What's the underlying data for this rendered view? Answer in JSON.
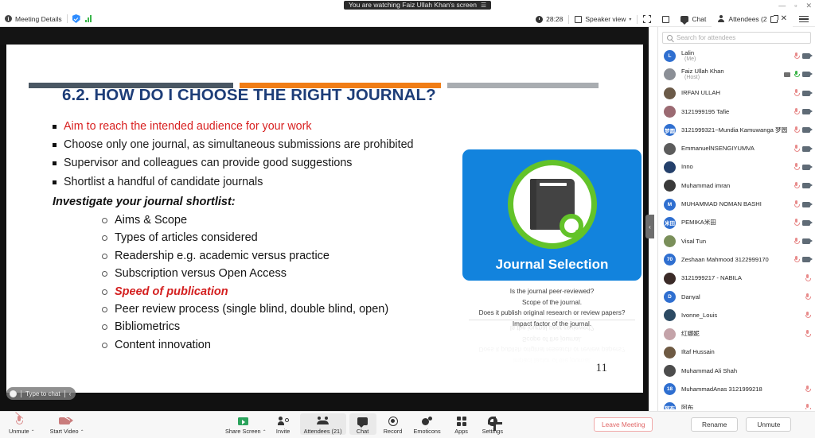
{
  "window": {
    "minimize": "—",
    "maximize": "▫",
    "close": "✕"
  },
  "screenshare_banner": {
    "text": "You are watching Faiz Ullah Khan's screen",
    "menu_icon": "menu-icon"
  },
  "topbar": {
    "meeting_details": "Meeting Details",
    "encryption_icon": "shield-check-icon",
    "network_icon": "signal-bars-icon",
    "timer": "28:28",
    "view_mode": "Speaker view",
    "view_caret": "▾",
    "fullscreen_icon": "expand-icon",
    "minimize_view_icon": "minimize-view-icon",
    "chat_tab": "Chat",
    "attendees_tab": "Attendees (2",
    "attendees_popout_icon": "popout-icon",
    "attendees_close_icon": "close-icon",
    "more_icon": "hamburger-icon"
  },
  "slide": {
    "title": "6.2. HOW DO I CHOOSE THE RIGHT JOURNAL?",
    "rules": [
      "dark",
      "orange",
      "gray"
    ],
    "bullets": [
      {
        "text": "Aim to reach the intended audience for your work",
        "color": "red"
      },
      {
        "text": "Choose only one journal, as simultaneous submissions are prohibited",
        "color": "black"
      },
      {
        "text": "Supervisor and colleagues can provide good suggestions",
        "color": "black"
      },
      {
        "text": "Shortlist a handful of candidate journals",
        "color": "black"
      }
    ],
    "sub_heading": "Investigate your journal shortlist:",
    "sub_items": [
      {
        "text": "Aims & Scope",
        "color": "black"
      },
      {
        "text": "Types of articles considered",
        "color": "black"
      },
      {
        "text": "Readership e.g. academic versus practice",
        "color": "black"
      },
      {
        "text": "Subscription versus Open Access",
        "color": "black"
      },
      {
        "text": "Speed of publication",
        "color": "red"
      },
      {
        "text": "Peer review process (single blind, double blind, open)",
        "color": "black"
      },
      {
        "text": "Bibliometrics",
        "color": "black"
      },
      {
        "text": "Content innovation",
        "color": "black"
      }
    ],
    "journal_card": {
      "title": "Journal Selection",
      "icon": "book-search-icon",
      "caption_lines": [
        "Is the journal peer-reviewed?",
        "Scope of the journal.",
        "Does it publish original research or review papers?",
        "Impact factor of the journal."
      ]
    },
    "page_number": "11",
    "colors": {
      "title": "#1d3d78",
      "accent_red": "#d42020",
      "rule_orange": "#f07d16",
      "tile_blue": "#1283dd",
      "ring_green": "#63c329"
    }
  },
  "chat_overlay": {
    "placeholder": "Type to chat",
    "collapse": "‹"
  },
  "panel_collapse": {
    "icon": "chevron-left-icon",
    "glyph": "‹"
  },
  "attendee_panel": {
    "search_placeholder": "Search for attendees",
    "attendees": [
      {
        "name": "Lalin",
        "sub": "(Me)",
        "initial": "L",
        "avatar_color": "#2f6fd0",
        "mic": "muted",
        "cam": true,
        "share": false
      },
      {
        "name": "Faiz Ullah Khan",
        "sub": "(Host)",
        "initial": "",
        "avatar_color": "#8b8f96",
        "mic": "unmuted",
        "cam": true,
        "share": true
      },
      {
        "name": "IRFAN ULLAH",
        "sub": "",
        "initial": "",
        "avatar_color": "#6b5a48",
        "mic": "muted",
        "cam": true,
        "share": false
      },
      {
        "name": "3121999195 Tafie",
        "sub": "",
        "initial": "",
        "avatar_color": "#9b6a72",
        "mic": "muted",
        "cam": true,
        "share": false
      },
      {
        "name": "3121999321~Mundia Kamuwanga 梦圆",
        "sub": "",
        "initial": "梦圆",
        "avatar_color": "#2f6fd0",
        "mic": "muted",
        "cam": true,
        "share": false
      },
      {
        "name": "EmmanuelNSENGIYUMVA",
        "sub": "",
        "initial": "",
        "avatar_color": "#5c5c5c",
        "mic": "muted",
        "cam": true,
        "share": false
      },
      {
        "name": "Inno",
        "sub": "",
        "initial": "",
        "avatar_color": "#24406b",
        "mic": "muted",
        "cam": true,
        "share": false
      },
      {
        "name": "Muhammad imran",
        "sub": "",
        "initial": "",
        "avatar_color": "#3a3a3a",
        "mic": "muted",
        "cam": true,
        "share": false
      },
      {
        "name": "MUHAMMAD NOMAN BASHI",
        "sub": "",
        "initial": "M",
        "avatar_color": "#2f6fd0",
        "mic": "muted",
        "cam": true,
        "share": false
      },
      {
        "name": "PEMIKA米田",
        "sub": "",
        "initial": "米田",
        "avatar_color": "#2f6fd0",
        "mic": "muted",
        "cam": true,
        "share": false
      },
      {
        "name": "Visal Tun",
        "sub": "",
        "initial": "",
        "avatar_color": "#7a8f5a",
        "mic": "muted",
        "cam": true,
        "share": false
      },
      {
        "name": "Zeshaan Mahmood 3122999170",
        "sub": "",
        "initial": "70",
        "avatar_color": "#2f6fd0",
        "mic": "muted",
        "cam": true,
        "share": false
      },
      {
        "name": "3121999217 - NABILA",
        "sub": "",
        "initial": "",
        "avatar_color": "#3b2b28",
        "mic": "muted",
        "cam": false,
        "share": false
      },
      {
        "name": "Danyal",
        "sub": "",
        "initial": "D",
        "avatar_color": "#2f6fd0",
        "mic": "muted",
        "cam": false,
        "share": false
      },
      {
        "name": "Ivonne_Louis",
        "sub": "",
        "initial": "",
        "avatar_color": "#2c4a63",
        "mic": "muted",
        "cam": false,
        "share": false
      },
      {
        "name": "红娜妮",
        "sub": "",
        "initial": "",
        "avatar_color": "#c4a3a9",
        "mic": "muted",
        "cam": false,
        "share": false
      },
      {
        "name": "Iltaf Hussain",
        "sub": "",
        "initial": "",
        "avatar_color": "#6e5a43",
        "mic": "none",
        "cam": false,
        "share": false
      },
      {
        "name": "Muhammad Ali Shah",
        "sub": "",
        "initial": "",
        "avatar_color": "#4d4d4d",
        "mic": "none",
        "cam": false,
        "share": false
      },
      {
        "name": "MuhammadAnas 3121999218",
        "sub": "",
        "initial": "18",
        "avatar_color": "#2f6fd0",
        "mic": "muted",
        "cam": false,
        "share": false
      },
      {
        "name": "阿布",
        "sub": "",
        "initial": "阿布",
        "avatar_color": "#2f6fd0",
        "mic": "muted",
        "cam": false,
        "share": false
      }
    ]
  },
  "bottom_toolbar": {
    "left": [
      {
        "label": "Unmute",
        "icon": "mic-muted-icon",
        "caret": "⌃"
      },
      {
        "label": "Start Video",
        "icon": "camera-off-icon",
        "caret": "⌃"
      }
    ],
    "center": [
      {
        "label": "Share Screen",
        "icon": "share-screen-icon",
        "caret": "⌃",
        "highlight": false
      },
      {
        "label": "Invite",
        "icon": "invite-person-icon",
        "highlight": false
      },
      {
        "label": "Attendees (21)",
        "icon": "people-icon",
        "highlight": true
      },
      {
        "label": "Chat",
        "icon": "chat-bubble-icon",
        "highlight": true
      },
      {
        "label": "Record",
        "icon": "record-icon",
        "highlight": false
      },
      {
        "label": "Emoticons",
        "icon": "emoji-icon",
        "highlight": false
      },
      {
        "label": "Apps",
        "icon": "apps-grid-icon",
        "highlight": false
      },
      {
        "label": "Settings",
        "icon": "gear-icon",
        "highlight": false
      }
    ],
    "leave_label": "Leave Meeting",
    "panel_buttons": [
      "Rename",
      "Unmute"
    ]
  }
}
